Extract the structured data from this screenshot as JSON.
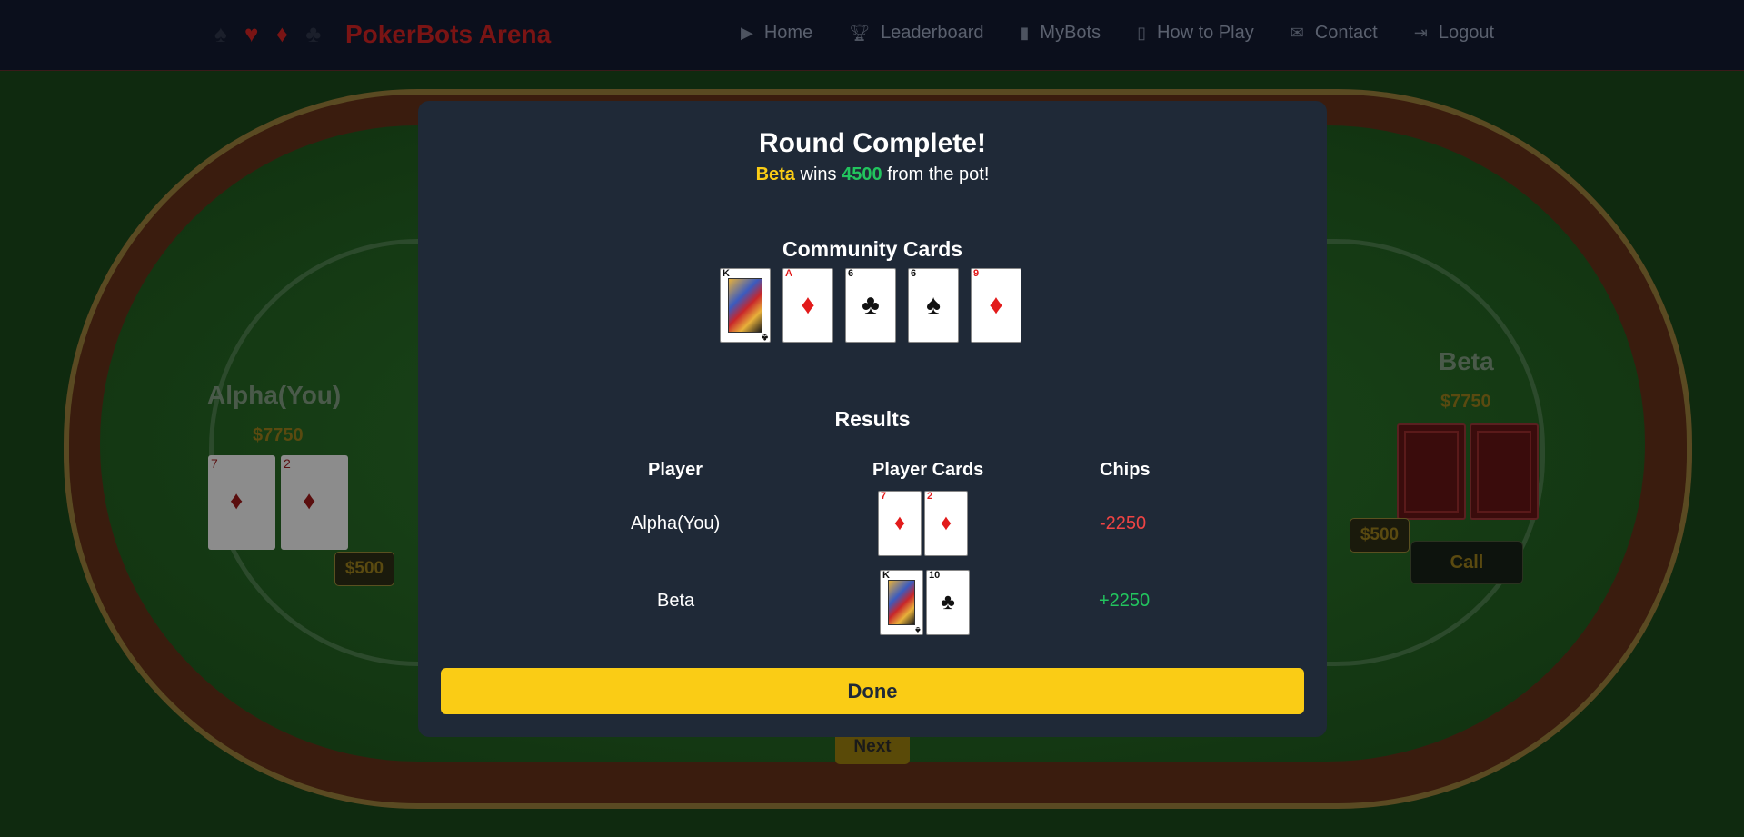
{
  "nav": {
    "brand": "PokerBots Arena",
    "suits": [
      "♠",
      "♥",
      "♦",
      "♣"
    ],
    "items": [
      {
        "label": "Home",
        "icon": "play-icon"
      },
      {
        "label": "Leaderboard",
        "icon": "trophy-icon"
      },
      {
        "label": "MyBots",
        "icon": "robot-icon"
      },
      {
        "label": "How to Play",
        "icon": "book-icon"
      },
      {
        "label": "Contact",
        "icon": "envelope-icon"
      },
      {
        "label": "Logout",
        "icon": "logout-icon"
      }
    ]
  },
  "table": {
    "player_left": {
      "name": "Alpha(You)",
      "chips": "$7750",
      "bet": "$500",
      "cards": [
        {
          "rank": "7",
          "suit": "♦"
        },
        {
          "rank": "2",
          "suit": "♦"
        }
      ]
    },
    "player_right": {
      "name": "Beta",
      "chips": "$7750",
      "bet": "$500"
    },
    "call_label": "Call",
    "next_label": "Next"
  },
  "modal": {
    "title": "Round Complete!",
    "winner": "Beta",
    "wins_text": "wins",
    "amount": "4500",
    "suffix": "from the pot!",
    "community_title": "Community Cards",
    "community_cards": [
      {
        "rank": "K",
        "suit": "♣",
        "color": "black",
        "face": true
      },
      {
        "rank": "A",
        "suit": "♦",
        "color": "red",
        "face": false
      },
      {
        "rank": "6",
        "suit": "♣",
        "color": "black",
        "face": false
      },
      {
        "rank": "6",
        "suit": "♠",
        "color": "black",
        "face": false
      },
      {
        "rank": "9",
        "suit": "♦",
        "color": "red",
        "face": false
      }
    ],
    "results_title": "Results",
    "headers": {
      "player": "Player",
      "cards": "Player Cards",
      "chips": "Chips"
    },
    "rows": [
      {
        "player": "Alpha(You)",
        "chips": "-2250",
        "cards": [
          {
            "rank": "7",
            "suit": "♦",
            "color": "red",
            "face": false
          },
          {
            "rank": "2",
            "suit": "♦",
            "color": "red",
            "face": false
          }
        ]
      },
      {
        "player": "Beta",
        "chips": "+2250",
        "cards": [
          {
            "rank": "K",
            "suit": "♠",
            "color": "black",
            "face": true
          },
          {
            "rank": "10",
            "suit": "♣",
            "color": "black",
            "face": false
          }
        ]
      }
    ],
    "done_label": "Done"
  },
  "colors": {
    "accent": "#facc15",
    "positive": "#22c55e",
    "negative": "#ef4444",
    "modal_bg": "#1f2937"
  }
}
